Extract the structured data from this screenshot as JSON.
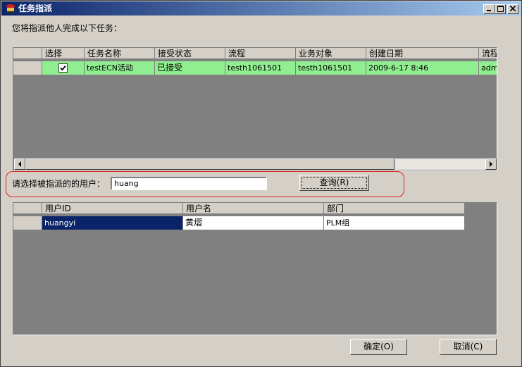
{
  "window": {
    "title": "任务指派",
    "min_label": "_",
    "close_label": "×"
  },
  "instruction": "您将指派他人完成以下任务：",
  "task_grid": {
    "columns": [
      "选择",
      "任务名称",
      "接受状态",
      "流程",
      "业务对象",
      "创建日期",
      "流程"
    ],
    "rows": [
      {
        "checked": true,
        "task_name": "testECN活动",
        "status": "已接受",
        "process": "testh1061501",
        "business_object": "testh1061501",
        "created": "2009-6-17 8:46",
        "process_owner": "admi"
      }
    ],
    "row_color": "#90ee90"
  },
  "user_search": {
    "label": "请选择被指派的的用户：",
    "value": "huang",
    "query_button": "查询(R)"
  },
  "user_grid": {
    "columns": [
      "用户ID",
      "用户名",
      "部门"
    ],
    "rows": [
      {
        "user_id": "huangyi",
        "user_name": "黄熠",
        "department": "PLM组"
      }
    ],
    "selected_color": "#0a246a"
  },
  "buttons": {
    "ok": "确定(O)",
    "cancel": "取消(C)"
  }
}
